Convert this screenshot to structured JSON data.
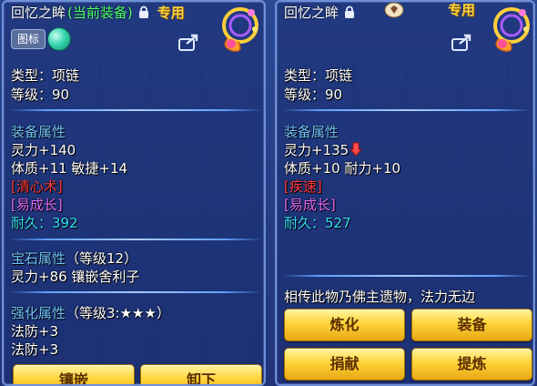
{
  "left": {
    "title_name": "回忆之眸",
    "title_equipped": "(当前装备)",
    "exclusive": "专用",
    "icon_badge": "图标",
    "type_label": "类型：项链",
    "level_label": "等级：90",
    "attr_header": "装备属性",
    "attr_lines": [
      "灵力+140",
      "体质+11 敏捷+14"
    ],
    "special_skill": "[清心术]",
    "special_effect": "[易成长]",
    "durability": "耐久：392",
    "gem_header": "宝石属性",
    "gem_level": "（等级12）",
    "gem_line": "灵力+86 镶嵌舍利子",
    "forge_header": "强化属性",
    "forge_level": "（等级3:★★★）",
    "forge_lines": [
      "法防+3",
      "法防+3"
    ],
    "buttons": {
      "inlay": "镶嵌",
      "unequip": "卸下"
    }
  },
  "right": {
    "title_name": "回忆之眸",
    "exclusive": "专用",
    "type_label": "类型：项链",
    "level_label": "等级：90",
    "attr_header": "装备属性",
    "attr_line1": "灵力+135",
    "attr_line2": "体质+10 耐力+10",
    "special_skill": "[疾速]",
    "special_effect": "[易成长]",
    "durability": "耐久：527",
    "description": "相传此物乃佛主遗物，法力无边",
    "buttons": {
      "refine": "炼化",
      "equip": "装备",
      "donate": "捐献",
      "extract": "提炼"
    }
  },
  "colors": {
    "equipped_green": "#4cff6a",
    "section_blue": "#6fc4ff",
    "skill_red": "#ff3a3a",
    "effect_purple": "#e06cff",
    "durability_cyan": "#35e0ff",
    "button_gold": "#ffd43a"
  }
}
